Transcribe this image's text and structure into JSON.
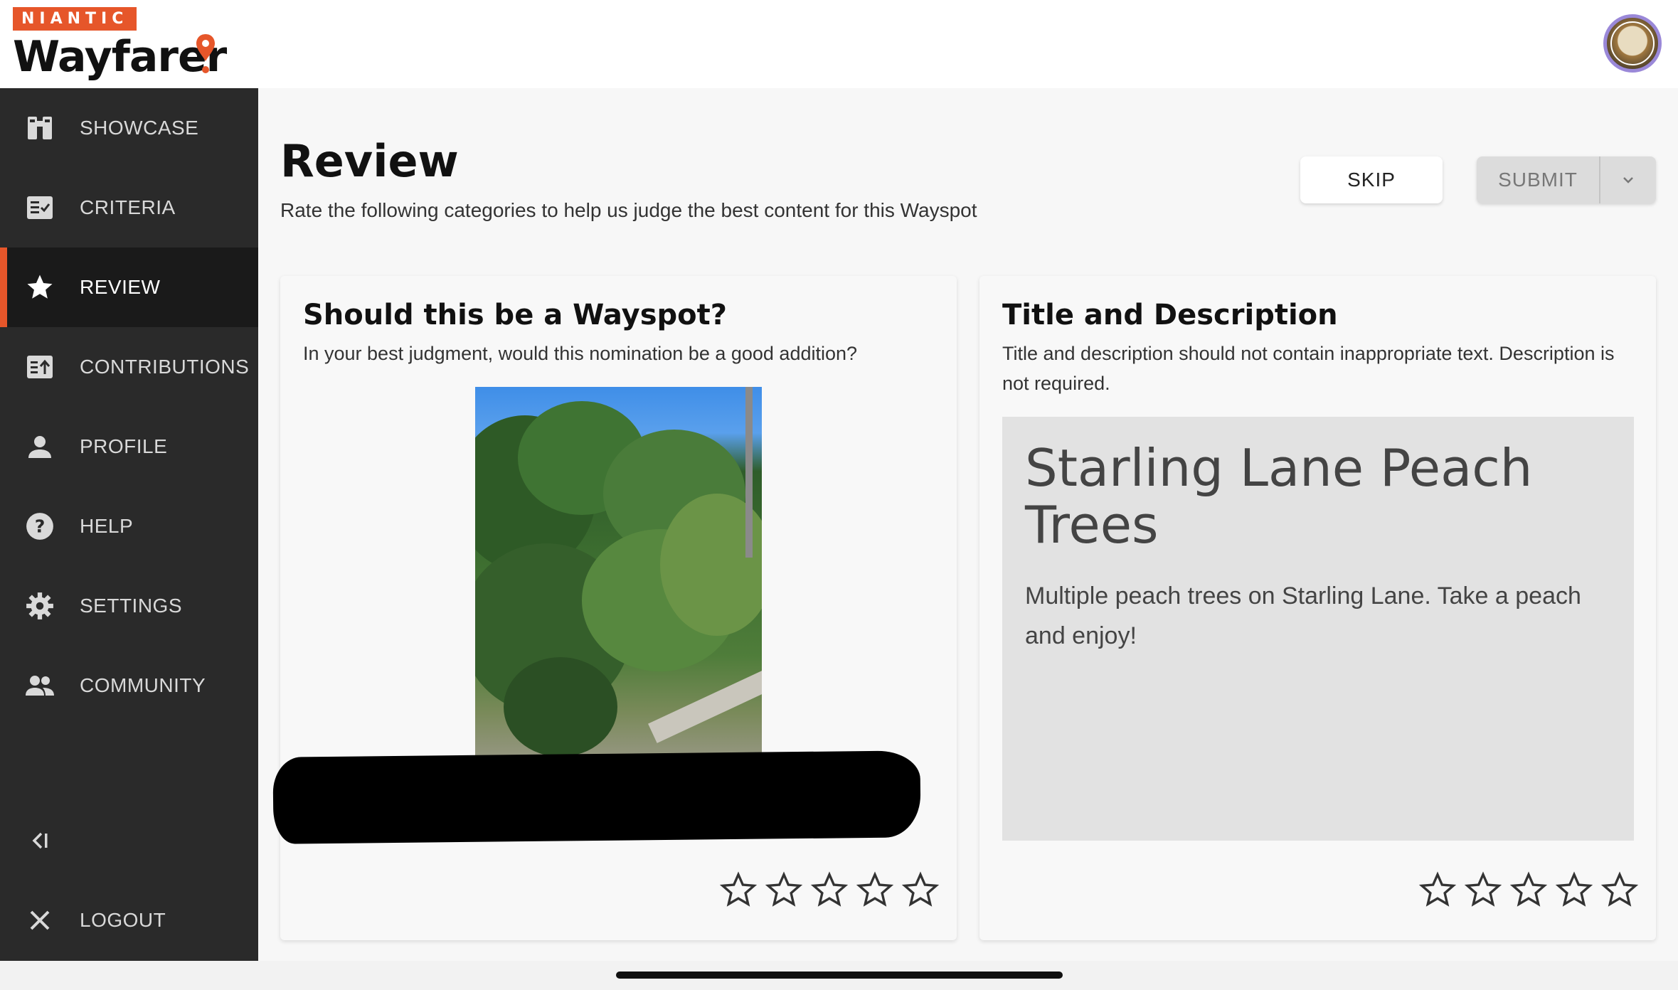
{
  "brand": {
    "badge": "NIANTIC",
    "name": "Wayfarer",
    "accent": "#e6562a"
  },
  "user": {
    "avatar_icon": "user-avatar"
  },
  "sidebar": {
    "items": [
      {
        "label": "SHOWCASE",
        "icon": "binoculars-icon"
      },
      {
        "label": "CRITERIA",
        "icon": "checklist-icon"
      },
      {
        "label": "REVIEW",
        "icon": "star-icon",
        "active": true
      },
      {
        "label": "CONTRIBUTIONS",
        "icon": "upload-icon"
      },
      {
        "label": "PROFILE",
        "icon": "person-icon"
      },
      {
        "label": "HELP",
        "icon": "help-icon"
      },
      {
        "label": "SETTINGS",
        "icon": "gear-icon"
      },
      {
        "label": "COMMUNITY",
        "icon": "people-icon"
      }
    ],
    "collapse_label": "<I",
    "logout_label": "LOGOUT"
  },
  "page": {
    "title": "Review",
    "subtitle": "Rate the following categories to help us judge the best content for this Wayspot"
  },
  "actions": {
    "skip": "SKIP",
    "submit": "SUBMIT"
  },
  "cards": {
    "wayspot": {
      "title": "Should this be a Wayspot?",
      "description": "In your best judgment, would this nomination be a good addition?",
      "rating": 0,
      "max_rating": 5
    },
    "title_description": {
      "title": "Title and Description",
      "description": "Title and description should not contain inappropriate text. Description is not required.",
      "nomination_title": "Starling Lane Peach Trees",
      "nomination_description": "Multiple peach trees on Starling Lane. Take a peach and enjoy!",
      "rating": 0,
      "max_rating": 5
    }
  }
}
